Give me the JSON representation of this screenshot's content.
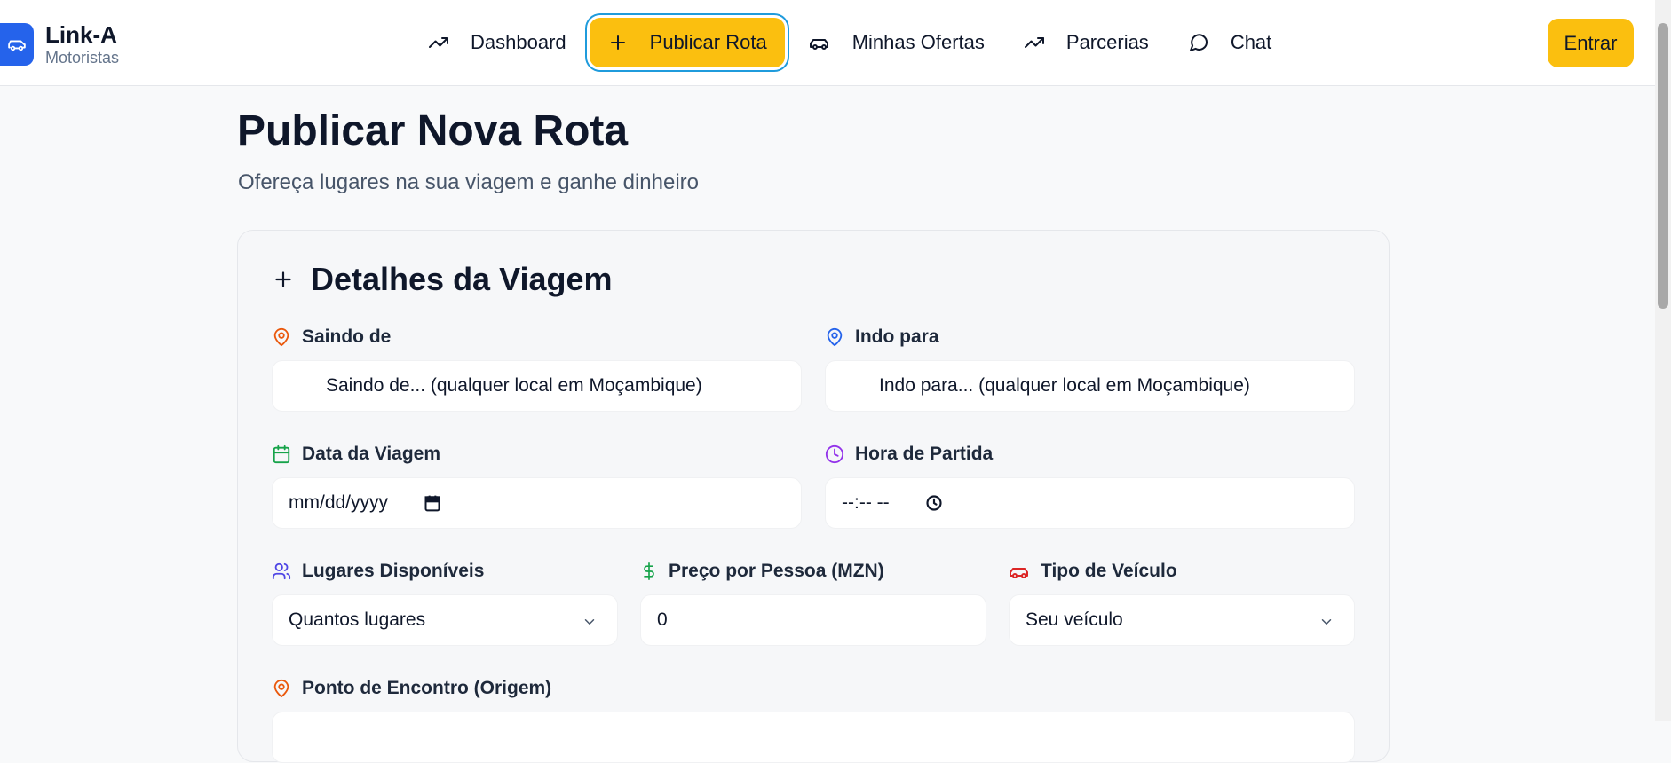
{
  "brand": {
    "name": "Link-A",
    "subtitle": "Motoristas"
  },
  "nav": {
    "items": [
      {
        "label": "Dashboard",
        "icon": "trending-up-icon"
      },
      {
        "label": "Publicar Rota",
        "icon": "plus-icon",
        "active": true
      },
      {
        "label": "Minhas Ofertas",
        "icon": "car-icon"
      },
      {
        "label": "Parcerias",
        "icon": "trending-up-icon"
      },
      {
        "label": "Chat",
        "icon": "message-circle-icon"
      }
    ],
    "enter_label": "Entrar"
  },
  "page": {
    "title": "Publicar Nova Rota",
    "subtitle": "Ofereça lugares na sua viagem e ganhe dinheiro"
  },
  "form": {
    "title": "Detalhes da Viagem",
    "from": {
      "label": "Saindo de",
      "placeholder": "Saindo de... (qualquer local em Moçambique)"
    },
    "to": {
      "label": "Indo para",
      "placeholder": "Indo para... (qualquer local em Moçambique)"
    },
    "date": {
      "label": "Data da Viagem",
      "placeholder": "mm/dd/yyyy"
    },
    "time": {
      "label": "Hora de Partida",
      "placeholder": "--:-- --"
    },
    "seats": {
      "label": "Lugares Disponíveis",
      "value": "Quantos lugares"
    },
    "price": {
      "label": "Preço por Pessoa (MZN)",
      "value": "0"
    },
    "vehicle": {
      "label": "Tipo de Veículo",
      "value": "Seu veículo"
    },
    "meeting_point": {
      "label": "Ponto de Encontro (Origem)"
    }
  },
  "colors": {
    "accent": "#fbbf0f",
    "brand": "#2563eb",
    "origin_pin": "#ea580c",
    "dest_pin": "#2563eb",
    "calendar": "#16a34a",
    "clock": "#9333ea",
    "users": "#4f46e5",
    "dollar": "#16a34a",
    "car": "#dc2626"
  }
}
